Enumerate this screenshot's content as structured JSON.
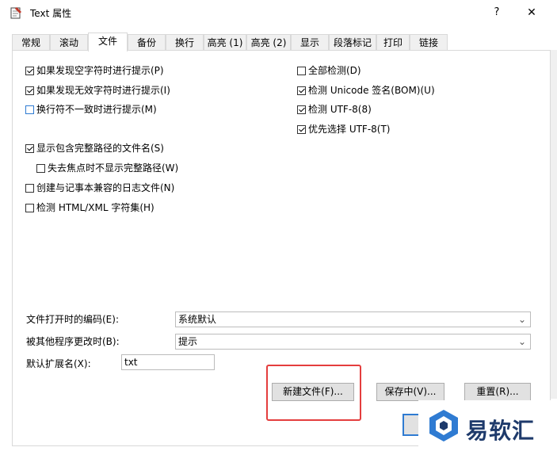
{
  "window": {
    "title": "Text 属性",
    "help_label": "?",
    "close_label": "✕"
  },
  "tabs": [
    {
      "label": "常规"
    },
    {
      "label": "滚动"
    },
    {
      "label": "文件",
      "active": true
    },
    {
      "label": "备份"
    },
    {
      "label": "换行"
    },
    {
      "label": "高亮 (1)"
    },
    {
      "label": "高亮 (2)"
    },
    {
      "label": "显示"
    },
    {
      "label": "段落标记"
    },
    {
      "label": "打印"
    },
    {
      "label": "链接"
    }
  ],
  "left_options": [
    {
      "label": "如果发现空字符时进行提示(P)",
      "checked": true
    },
    {
      "label": "如果发现无效字符时进行提示(I)",
      "checked": true
    },
    {
      "label": "换行符不一致时进行提示(M)",
      "checked": false
    },
    {
      "label": "显示包含完整路径的文件名(S)",
      "checked": true
    },
    {
      "label": "失去焦点时不显示完整路径(W)",
      "checked": false
    },
    {
      "label": "创建与记事本兼容的日志文件(N)",
      "checked": false
    },
    {
      "label": "检测 HTML/XML 字符集(H)",
      "checked": false
    }
  ],
  "right_options": [
    {
      "label": "全部检测(D)",
      "checked": false
    },
    {
      "label": "检测 Unicode 签名(BOM)(U)",
      "checked": true
    },
    {
      "label": "检测 UTF-8(8)",
      "checked": true
    },
    {
      "label": "优先选择 UTF-8(T)",
      "checked": true
    }
  ],
  "encoding": {
    "label": "文件打开时的编码(E):",
    "value": "系统默认"
  },
  "modified": {
    "label": "被其他程序更改时(B):",
    "value": "提示"
  },
  "default_ext": {
    "label": "默认扩展名(X):",
    "value": "txt"
  },
  "buttons": {
    "new_file": "新建文件(F)...",
    "save_as": "保存中(V)...",
    "reset": "重置(R)..."
  },
  "watermark": {
    "text": "易软汇"
  },
  "colors": {
    "highlight": "#e43e3e",
    "focus_blue": "#2f7bd2",
    "brand_navy": "#1e3a6b"
  }
}
